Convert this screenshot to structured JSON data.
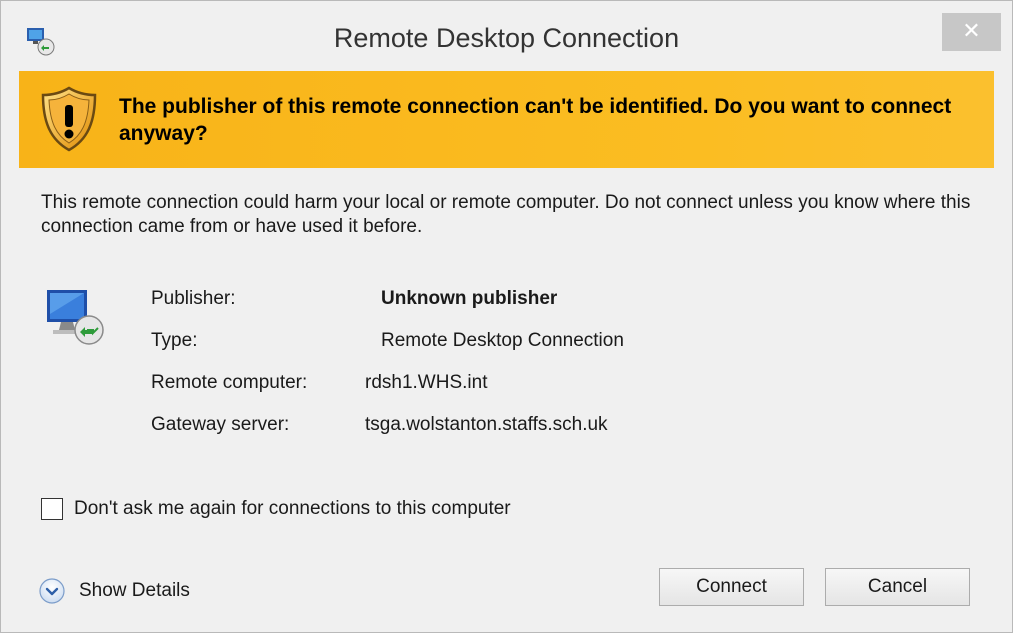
{
  "window": {
    "title": "Remote Desktop Connection",
    "close_label": "✕"
  },
  "banner": {
    "message": "The publisher of this remote connection can't be identified. Do you want to connect anyway?",
    "color": "#f9b81a"
  },
  "warning_text": "This remote connection could harm your local or remote computer. Do not connect unless you know where this connection came from or have used it before.",
  "details": [
    {
      "label": "Publisher:",
      "value": "Unknown publisher"
    },
    {
      "label": "Type:",
      "value": "Remote Desktop Connection"
    },
    {
      "label": "Remote computer:",
      "value": "rdsh1.WHS.int"
    },
    {
      "label": "Gateway server:",
      "value": "tsga.wolstanton.staffs.sch.uk"
    }
  ],
  "checkbox": {
    "label": "Don't ask me again for connections to this computer",
    "checked": false
  },
  "footer": {
    "show_details_label": "Show Details",
    "connect_label": "Connect",
    "cancel_label": "Cancel"
  },
  "icons": {
    "app": "remote-desktop-icon",
    "banner": "warning-shield-icon",
    "computer": "remote-computer-icon",
    "details_toggle": "chevron-down-circle-icon"
  }
}
